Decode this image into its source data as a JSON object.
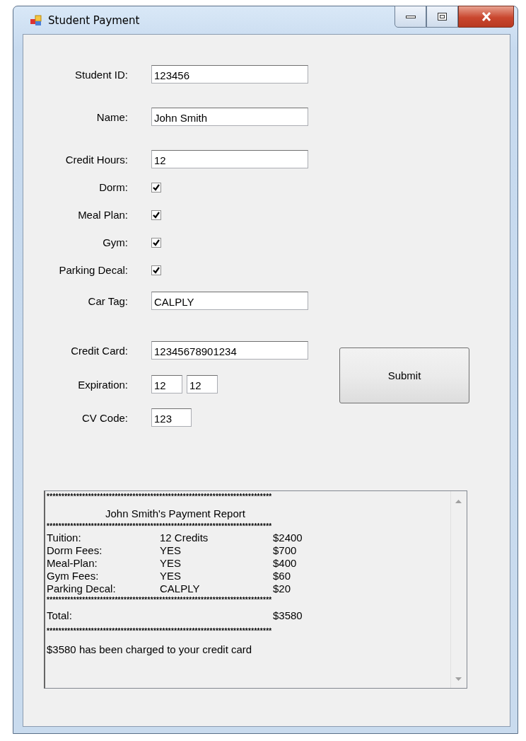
{
  "window": {
    "title": "Student Payment"
  },
  "fields": [
    {
      "kind": "text",
      "label": "Student ID:",
      "value": "123456"
    },
    {
      "kind": "text",
      "label": "Name:",
      "value": "John Smith"
    },
    {
      "kind": "text",
      "label": "Credit Hours:",
      "value": "12"
    },
    {
      "kind": "check",
      "label": "Dorm:",
      "checked": true
    },
    {
      "kind": "check",
      "label": "Meal Plan:",
      "checked": true
    },
    {
      "kind": "check",
      "label": "Gym:",
      "checked": true
    },
    {
      "kind": "check",
      "label": "Parking Decal:",
      "checked": true
    },
    {
      "kind": "text",
      "label": "Car Tag:",
      "value": "CALPLY"
    },
    {
      "kind": "text",
      "label": "Credit Card:",
      "value": "12345678901234"
    },
    {
      "kind": "pair",
      "label": "Expiration:",
      "values": [
        "12",
        "12"
      ]
    },
    {
      "kind": "short",
      "label": "CV Code:",
      "value": "123"
    }
  ],
  "submit": "Submit",
  "report": [
    {
      "kind": "rule",
      "text": "****************************************************************************"
    },
    {
      "kind": "title",
      "text": "John Smith's Payment Report"
    },
    {
      "kind": "rule",
      "text": "****************************************************************************"
    },
    {
      "kind": "row",
      "cells": [
        "Tuition:",
        "12 Credits",
        "$2400"
      ]
    },
    {
      "kind": "row",
      "cells": [
        "Dorm Fees:",
        "YES",
        "$700"
      ]
    },
    {
      "kind": "row",
      "cells": [
        "Meal-Plan:",
        "YES",
        "$400"
      ]
    },
    {
      "kind": "row",
      "cells": [
        "Gym Fees:",
        "YES",
        "$60"
      ]
    },
    {
      "kind": "row",
      "cells": [
        "Parking Decal:",
        "CALPLY",
        "$20"
      ]
    },
    {
      "kind": "rule",
      "text": "****************************************************************************"
    },
    {
      "kind": "row",
      "cells": [
        "Total:",
        "",
        "$3580"
      ]
    },
    {
      "kind": "rule",
      "text": "****************************************************************************"
    },
    {
      "kind": "text",
      "text": "$3580 has been charged to your credit card"
    }
  ]
}
